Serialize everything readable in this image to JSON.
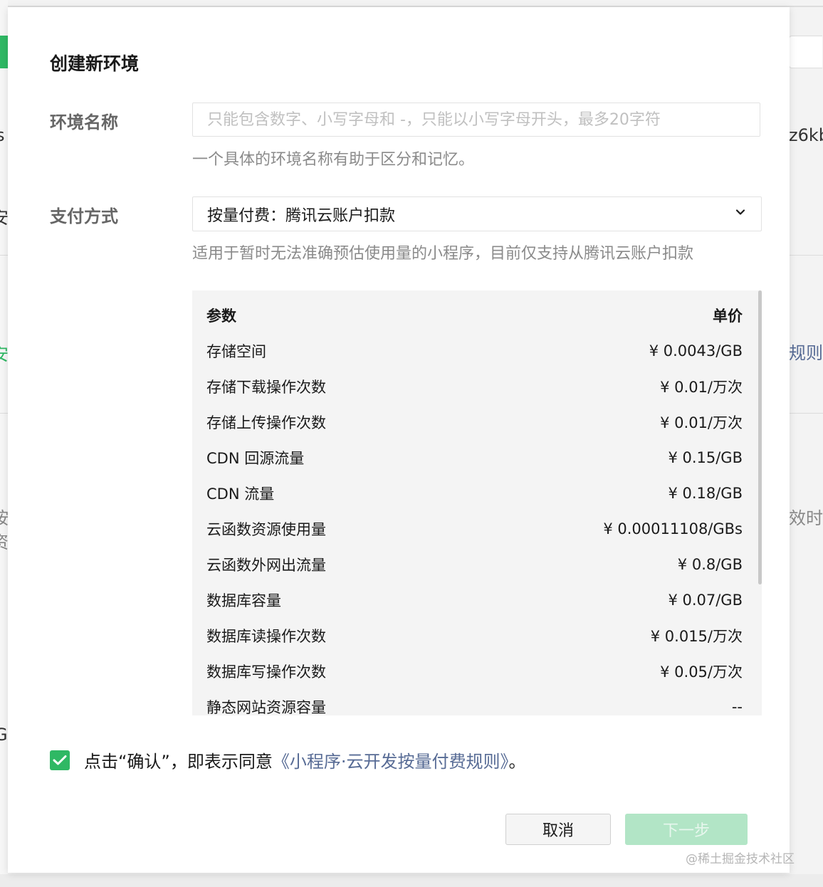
{
  "background": {
    "right_fragments": [
      "z6kb",
      "规则",
      "效时"
    ],
    "left_fragments": [
      "s",
      "安",
      "安",
      "按",
      "资",
      "G"
    ]
  },
  "dialog": {
    "title": "创建新环境",
    "env_name": {
      "label": "环境名称",
      "value": "",
      "placeholder": "只能包含数字、小写字母和 -，只能以小写字母开头，最多20字符",
      "hint": "一个具体的环境名称有助于区分和记忆。"
    },
    "payment": {
      "label": "支付方式",
      "selected": "按量付费：腾讯云账户扣款",
      "hint": "适用于暂时无法准确预估使用量的小程序，目前仅支持从腾讯云账户扣款"
    },
    "price_table": {
      "header": {
        "param": "参数",
        "price": "单价"
      },
      "rows": [
        {
          "param": "存储空间",
          "price": "¥ 0.0043/GB"
        },
        {
          "param": "存储下载操作次数",
          "price": "¥ 0.01/万次"
        },
        {
          "param": "存储上传操作次数",
          "price": "¥ 0.01/万次"
        },
        {
          "param": "CDN 回源流量",
          "price": "¥ 0.15/GB"
        },
        {
          "param": "CDN 流量",
          "price": "¥ 0.18/GB"
        },
        {
          "param": "云函数资源使用量",
          "price": "¥ 0.00011108/GBs"
        },
        {
          "param": "云函数外网出流量",
          "price": "¥ 0.8/GB"
        },
        {
          "param": "数据库容量",
          "price": "¥ 0.07/GB"
        },
        {
          "param": "数据库读操作次数",
          "price": "¥ 0.015/万次"
        },
        {
          "param": "数据库写操作次数",
          "price": "¥ 0.05/万次"
        },
        {
          "param": "静态网站资源容量",
          "price": "--"
        }
      ]
    },
    "agreement": {
      "checked": true,
      "prefix": "点击“确认”，即表示同意",
      "link": "《小程序·云开发按量付费规则》",
      "suffix": "。"
    },
    "buttons": {
      "cancel": "取消",
      "next": "下一步"
    }
  },
  "watermark": "@稀土掘金技术社区",
  "colors": {
    "accent_green": "#2fb864",
    "link_blue": "#576b95",
    "disabled_green": "#b2e5c6"
  }
}
